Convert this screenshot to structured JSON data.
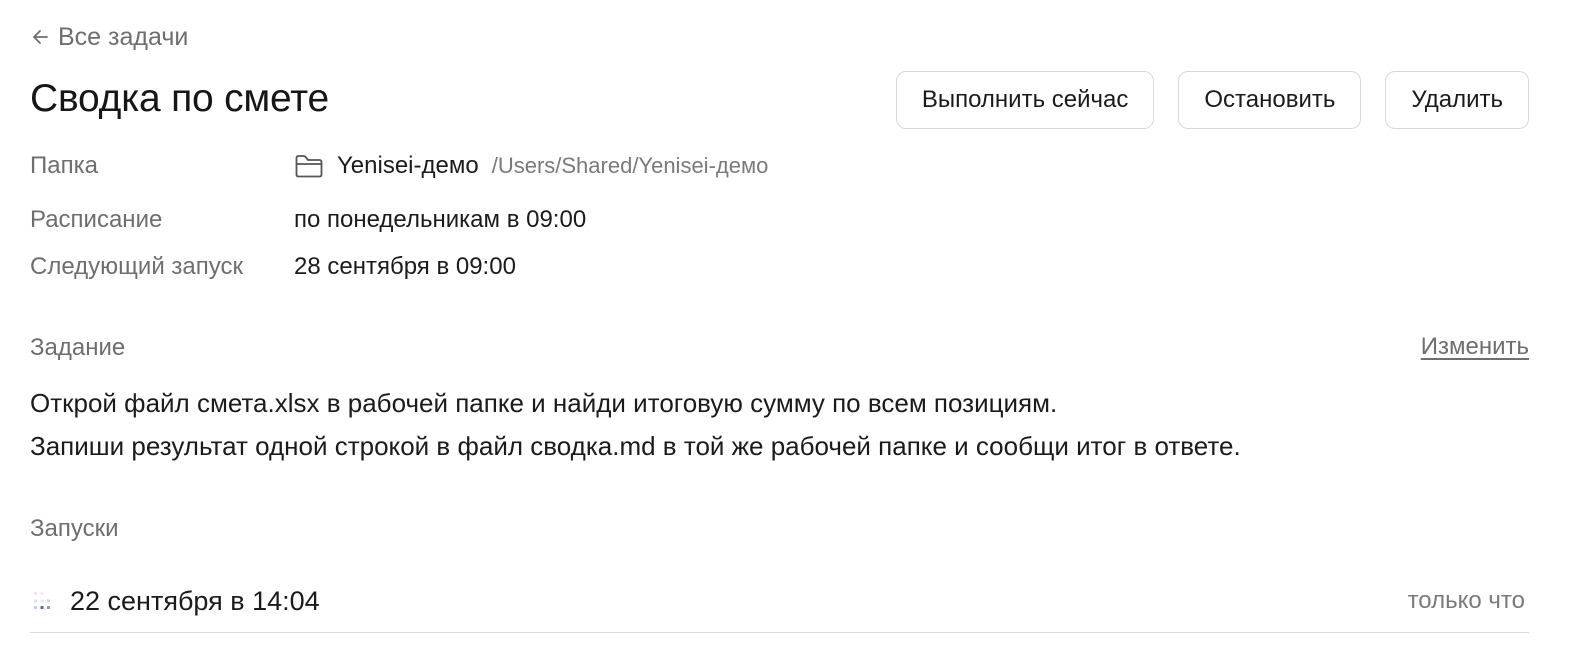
{
  "nav": {
    "back_label": "Все задачи",
    "back_icon": "arrow-left-icon"
  },
  "header": {
    "title": "Сводка по смете",
    "actions": {
      "run_now": "Выполнить сейчас",
      "stop": "Остановить",
      "delete": "Удалить"
    }
  },
  "meta": {
    "folder": {
      "label": "Папка",
      "icon": "folder-icon",
      "name": "Yenisei-демо",
      "path": "/Users/Shared/Yenisei-демо"
    },
    "schedule": {
      "label": "Расписание",
      "value": "по понедельникам в 09:00"
    },
    "next_run": {
      "label": "Следующий запуск",
      "value": "28 сентября в 09:00"
    }
  },
  "task": {
    "label": "Задание",
    "edit_label": "Изменить",
    "lines": [
      "Открой файл смета.xlsx в рабочей папке и найди итоговую сумму по всем позициям.",
      "Запиши результат одной строкой в файл сводка.md в той же рабочей папке и сообщи итог в ответе."
    ]
  },
  "runs": {
    "label": "Запуски",
    "items": [
      {
        "status_icon": "loading-spinner-icon",
        "date": "22 сентября в 14:04",
        "relative": "только что"
      }
    ]
  },
  "colors": {
    "text_primary": "#1b1b1b",
    "text_muted": "#6e6e6e",
    "border": "#d9d9d9",
    "spinner_accent": "#3b6fd6"
  }
}
